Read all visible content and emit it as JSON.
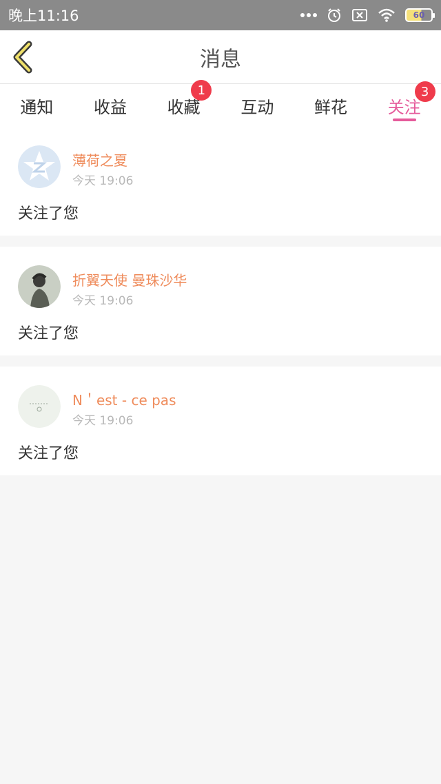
{
  "status_bar": {
    "time": "晚上11:16",
    "battery": "60"
  },
  "navbar": {
    "title": "消息"
  },
  "tabs": [
    {
      "label": "通知",
      "badge": ""
    },
    {
      "label": "收益",
      "badge": ""
    },
    {
      "label": "收藏",
      "badge": "1"
    },
    {
      "label": "互动",
      "badge": ""
    },
    {
      "label": "鲜花",
      "badge": ""
    },
    {
      "label": "关注",
      "badge": "3",
      "active": true
    }
  ],
  "messages": [
    {
      "name": "薄荷之夏",
      "time": "今天 19:06",
      "text": "关注了您"
    },
    {
      "name": "折翼天使 曼珠沙华",
      "time": "今天 19:06",
      "text": "关注了您"
    },
    {
      "name": "N＇est - ce pas",
      "time": "今天 19:06",
      "text": "关注了您"
    }
  ],
  "colors": {
    "accent": "#e55b9b",
    "name": "#ef8c5c",
    "badge": "#ef3b4b"
  }
}
